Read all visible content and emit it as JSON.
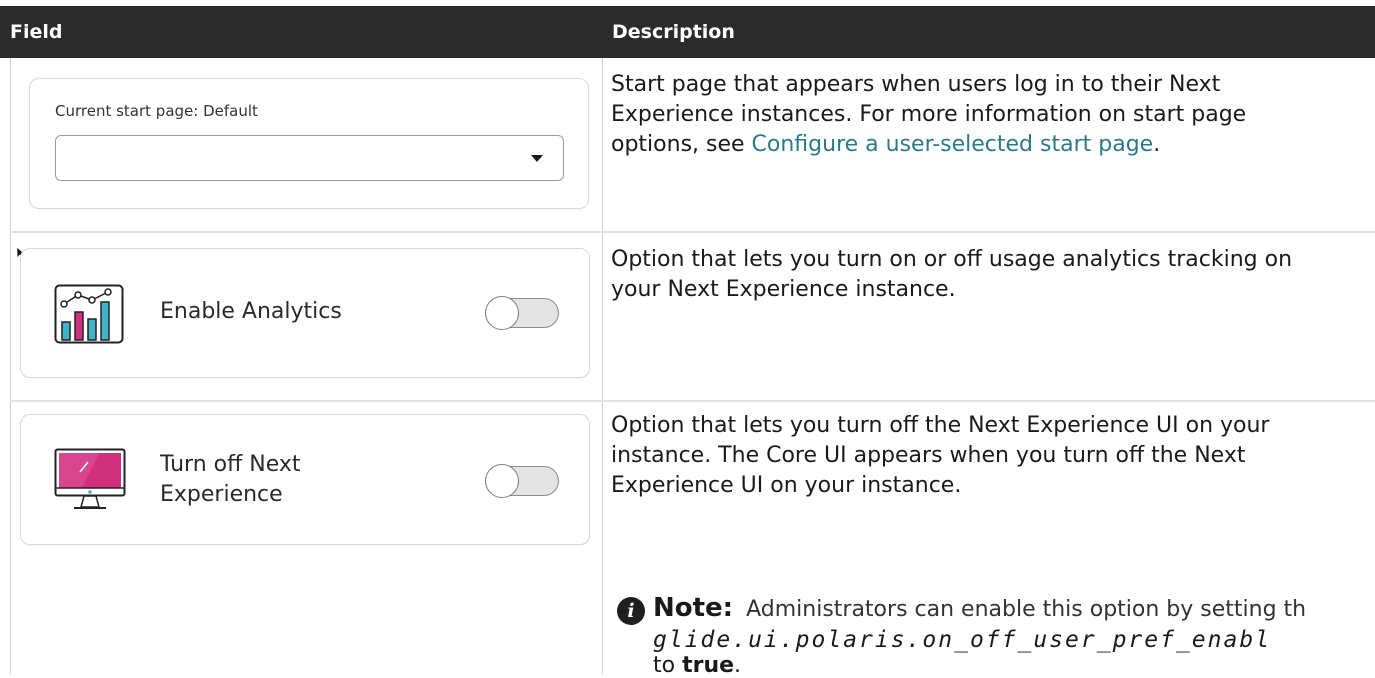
{
  "table": {
    "headers": {
      "field": "Field",
      "description": "Description"
    }
  },
  "rows": {
    "start_page": {
      "label": "Current start page: Default",
      "select_value": "",
      "desc_lines": [
        "Start page that appears when users log in to their Next",
        "Experience instances. For more information on start page"
      ],
      "desc_prefix": "options, see ",
      "link_text": "Configure a user-selected start page",
      "desc_suffix": "."
    },
    "analytics": {
      "label": "Enable Analytics",
      "toggle_on": false,
      "desc_lines": [
        "Option that lets you turn on or off usage analytics tracking on",
        "your Next Experience instance."
      ]
    },
    "next_experience": {
      "label_line1": "Turn off Next",
      "label_line2": "Experience",
      "toggle_on": false,
      "desc_lines": [
        "Option that lets you turn off the Next Experience UI on your",
        "instance. The Core UI appears when you turn off the Next",
        "Experience UI on your instance."
      ],
      "note": {
        "title": "Note:",
        "text": "Administrators can enable this option by setting th",
        "property": "glide.ui.polaris.on_off_user_pref_enabl",
        "to_prefix": "to ",
        "value": "true",
        "to_suffix": "."
      }
    }
  },
  "icons": {
    "analytics": "bar-chart-icon",
    "monitor": "monitor-icon",
    "info": "info-icon",
    "dropdown": "chevron-down-icon"
  },
  "colors": {
    "header_bg": "#2b2b2b",
    "link": "#2a7a8c",
    "accent_pink": "#d0307e",
    "accent_teal": "#3fb4c9"
  }
}
